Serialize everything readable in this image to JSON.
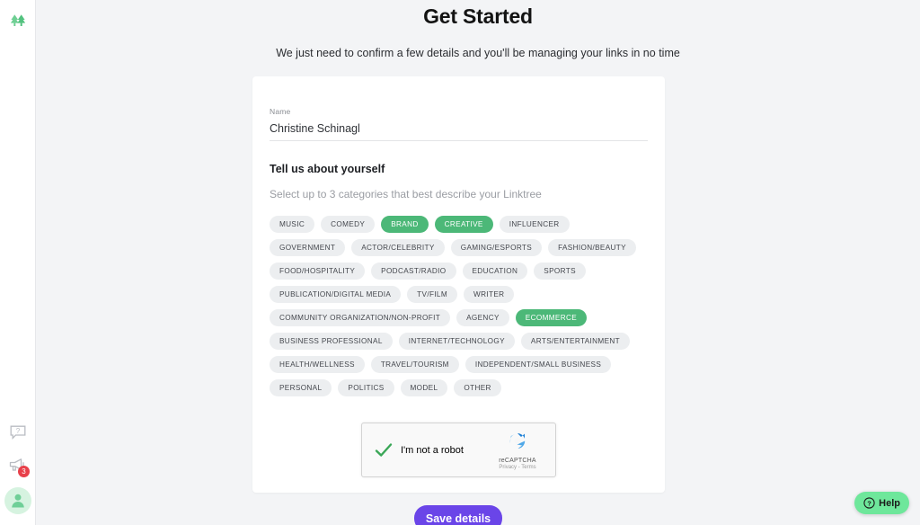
{
  "sidebar": {
    "logo": "linktree-logo",
    "help_icon": "question-speech-bubble-icon",
    "announcements_icon": "megaphone-icon",
    "announcements_badge": "3",
    "avatar_icon": "user-avatar-icon"
  },
  "header": {
    "title": "Get Started",
    "subtitle": "We just need to confirm a few details and you'll be managing your links in no time"
  },
  "form": {
    "name_label": "Name",
    "name_value": "Christine Schinagl",
    "name_placeholder": "Name",
    "section_title": "Tell us about yourself",
    "section_help": "Select up to 3 categories that best describe your Linktree"
  },
  "categories": [
    {
      "label": "MUSIC",
      "selected": false
    },
    {
      "label": "COMEDY",
      "selected": false
    },
    {
      "label": "BRAND",
      "selected": true
    },
    {
      "label": "CREATIVE",
      "selected": true
    },
    {
      "label": "INFLUENCER",
      "selected": false
    },
    {
      "label": "GOVERNMENT",
      "selected": false
    },
    {
      "label": "ACTOR/CELEBRITY",
      "selected": false
    },
    {
      "label": "GAMING/ESPORTS",
      "selected": false
    },
    {
      "label": "FASHION/BEAUTY",
      "selected": false
    },
    {
      "label": "FOOD/HOSPITALITY",
      "selected": false
    },
    {
      "label": "PODCAST/RADIO",
      "selected": false
    },
    {
      "label": "EDUCATION",
      "selected": false
    },
    {
      "label": "SPORTS",
      "selected": false
    },
    {
      "label": "PUBLICATION/DIGITAL MEDIA",
      "selected": false
    },
    {
      "label": "TV/FILM",
      "selected": false
    },
    {
      "label": "WRITER",
      "selected": false
    },
    {
      "label": "COMMUNITY ORGANIZATION/NON-PROFIT",
      "selected": false
    },
    {
      "label": "AGENCY",
      "selected": false
    },
    {
      "label": "ECOMMERCE",
      "selected": true
    },
    {
      "label": "BUSINESS PROFESSIONAL",
      "selected": false
    },
    {
      "label": "INTERNET/TECHNOLOGY",
      "selected": false
    },
    {
      "label": "ARTS/ENTERTAINMENT",
      "selected": false
    },
    {
      "label": "HEALTH/WELLNESS",
      "selected": false
    },
    {
      "label": "TRAVEL/TOURISM",
      "selected": false
    },
    {
      "label": "INDEPENDENT/SMALL BUSINESS",
      "selected": false
    },
    {
      "label": "PERSONAL",
      "selected": false
    },
    {
      "label": "POLITICS",
      "selected": false
    },
    {
      "label": "MODEL",
      "selected": false
    },
    {
      "label": "OTHER",
      "selected": false
    }
  ],
  "recaptcha": {
    "label": "I'm not a robot",
    "brand": "reCAPTCHA",
    "links": "Privacy - Terms",
    "checked": true
  },
  "actions": {
    "save_label": "Save details"
  },
  "help_widget": {
    "label": "Help",
    "icon": "question-mark-circle-icon"
  },
  "colors": {
    "accent_green": "#4cb878",
    "help_green": "#6ee79b",
    "save_purple": "#6a45e8",
    "badge_red": "#e8404a",
    "page_bg": "#f3f4f6",
    "chip_bg": "#eceef0"
  }
}
